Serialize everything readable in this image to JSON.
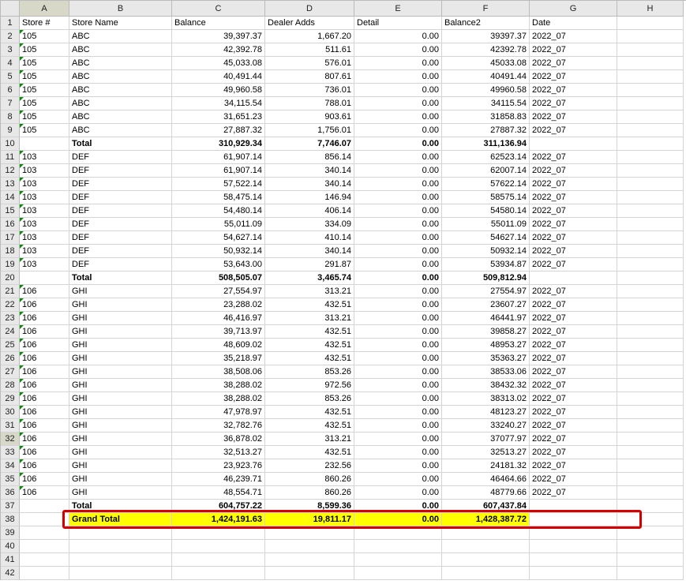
{
  "columns": [
    "",
    "A",
    "B",
    "C",
    "D",
    "E",
    "F",
    "G",
    "H"
  ],
  "headers": {
    "A": "Store #",
    "B": "Store Name",
    "C": "Balance",
    "D": "Dealer Adds",
    "E": "Detail",
    "F": "Balance2",
    "G": "Date"
  },
  "rows": [
    {
      "r": 2,
      "A": "105",
      "B": "ABC",
      "C": "39,397.37",
      "D": "1,667.20",
      "E": "0.00",
      "F": "39397.37",
      "G": "2022_07"
    },
    {
      "r": 3,
      "A": "105",
      "B": "ABC",
      "C": "42,392.78",
      "D": "511.61",
      "E": "0.00",
      "F": "42392.78",
      "G": "2022_07"
    },
    {
      "r": 4,
      "A": "105",
      "B": "ABC",
      "C": "45,033.08",
      "D": "576.01",
      "E": "0.00",
      "F": "45033.08",
      "G": "2022_07"
    },
    {
      "r": 5,
      "A": "105",
      "B": "ABC",
      "C": "40,491.44",
      "D": "807.61",
      "E": "0.00",
      "F": "40491.44",
      "G": "2022_07"
    },
    {
      "r": 6,
      "A": "105",
      "B": "ABC",
      "C": "49,960.58",
      "D": "736.01",
      "E": "0.00",
      "F": "49960.58",
      "G": "2022_07"
    },
    {
      "r": 7,
      "A": "105",
      "B": "ABC",
      "C": "34,115.54",
      "D": "788.01",
      "E": "0.00",
      "F": "34115.54",
      "G": "2022_07"
    },
    {
      "r": 8,
      "A": "105",
      "B": "ABC",
      "C": "31,651.23",
      "D": "903.61",
      "E": "0.00",
      "F": "31858.83",
      "G": "2022_07"
    },
    {
      "r": 9,
      "A": "105",
      "B": "ABC",
      "C": "27,887.32",
      "D": "1,756.01",
      "E": "0.00",
      "F": "27887.32",
      "G": "2022_07"
    },
    {
      "r": 10,
      "total": true,
      "B": "Total",
      "C": "310,929.34",
      "D": "7,746.07",
      "E": "0.00",
      "F": "311,136.94"
    },
    {
      "r": 11,
      "A": "103",
      "B": "DEF",
      "C": "61,907.14",
      "D": "856.14",
      "E": "0.00",
      "F": "62523.14",
      "G": "2022_07"
    },
    {
      "r": 12,
      "A": "103",
      "B": "DEF",
      "C": "61,907.14",
      "D": "340.14",
      "E": "0.00",
      "F": "62007.14",
      "G": "2022_07"
    },
    {
      "r": 13,
      "A": "103",
      "B": "DEF",
      "C": "57,522.14",
      "D": "340.14",
      "E": "0.00",
      "F": "57622.14",
      "G": "2022_07"
    },
    {
      "r": 14,
      "A": "103",
      "B": "DEF",
      "C": "58,475.14",
      "D": "146.94",
      "E": "0.00",
      "F": "58575.14",
      "G": "2022_07"
    },
    {
      "r": 15,
      "A": "103",
      "B": "DEF",
      "C": "54,480.14",
      "D": "406.14",
      "E": "0.00",
      "F": "54580.14",
      "G": "2022_07"
    },
    {
      "r": 16,
      "A": "103",
      "B": "DEF",
      "C": "55,011.09",
      "D": "334.09",
      "E": "0.00",
      "F": "55011.09",
      "G": "2022_07"
    },
    {
      "r": 17,
      "A": "103",
      "B": "DEF",
      "C": "54,627.14",
      "D": "410.14",
      "E": "0.00",
      "F": "54627.14",
      "G": "2022_07"
    },
    {
      "r": 18,
      "A": "103",
      "B": "DEF",
      "C": "50,932.14",
      "D": "340.14",
      "E": "0.00",
      "F": "50932.14",
      "G": "2022_07"
    },
    {
      "r": 19,
      "A": "103",
      "B": "DEF",
      "C": "53,643.00",
      "D": "291.87",
      "E": "0.00",
      "F": "53934.87",
      "G": "2022_07"
    },
    {
      "r": 20,
      "total": true,
      "B": "Total",
      "C": "508,505.07",
      "D": "3,465.74",
      "E": "0.00",
      "F": "509,812.94"
    },
    {
      "r": 21,
      "A": "106",
      "B": "GHI",
      "C": "27,554.97",
      "D": "313.21",
      "E": "0.00",
      "F": "27554.97",
      "G": "2022_07"
    },
    {
      "r": 22,
      "A": "106",
      "B": "GHI",
      "C": "23,288.02",
      "D": "432.51",
      "E": "0.00",
      "F": "23607.27",
      "G": "2022_07"
    },
    {
      "r": 23,
      "A": "106",
      "B": "GHI",
      "C": "46,416.97",
      "D": "313.21",
      "E": "0.00",
      "F": "46441.97",
      "G": "2022_07"
    },
    {
      "r": 24,
      "A": "106",
      "B": "GHI",
      "C": "39,713.97",
      "D": "432.51",
      "E": "0.00",
      "F": "39858.27",
      "G": "2022_07"
    },
    {
      "r": 25,
      "A": "106",
      "B": "GHI",
      "C": "48,609.02",
      "D": "432.51",
      "E": "0.00",
      "F": "48953.27",
      "G": "2022_07"
    },
    {
      "r": 26,
      "A": "106",
      "B": "GHI",
      "C": "35,218.97",
      "D": "432.51",
      "E": "0.00",
      "F": "35363.27",
      "G": "2022_07"
    },
    {
      "r": 27,
      "A": "106",
      "B": "GHI",
      "C": "38,508.06",
      "D": "853.26",
      "E": "0.00",
      "F": "38533.06",
      "G": "2022_07"
    },
    {
      "r": 28,
      "A": "106",
      "B": "GHI",
      "C": "38,288.02",
      "D": "972.56",
      "E": "0.00",
      "F": "38432.32",
      "G": "2022_07"
    },
    {
      "r": 29,
      "A": "106",
      "B": "GHI",
      "C": "38,288.02",
      "D": "853.26",
      "E": "0.00",
      "F": "38313.02",
      "G": "2022_07"
    },
    {
      "r": 30,
      "A": "106",
      "B": "GHI",
      "C": "47,978.97",
      "D": "432.51",
      "E": "0.00",
      "F": "48123.27",
      "G": "2022_07"
    },
    {
      "r": 31,
      "A": "106",
      "B": "GHI",
      "C": "32,782.76",
      "D": "432.51",
      "E": "0.00",
      "F": "33240.27",
      "G": "2022_07"
    },
    {
      "r": 32,
      "A": "106",
      "B": "GHI",
      "C": "36,878.02",
      "D": "313.21",
      "E": "0.00",
      "F": "37077.97",
      "G": "2022_07"
    },
    {
      "r": 33,
      "A": "106",
      "B": "GHI",
      "C": "32,513.27",
      "D": "432.51",
      "E": "0.00",
      "F": "32513.27",
      "G": "2022_07"
    },
    {
      "r": 34,
      "A": "106",
      "B": "GHI",
      "C": "23,923.76",
      "D": "232.56",
      "E": "0.00",
      "F": "24181.32",
      "G": "2022_07"
    },
    {
      "r": 35,
      "A": "106",
      "B": "GHI",
      "C": "46,239.71",
      "D": "860.26",
      "E": "0.00",
      "F": "46464.66",
      "G": "2022_07"
    },
    {
      "r": 36,
      "A": "106",
      "B": "GHI",
      "C": "48,554.71",
      "D": "860.26",
      "E": "0.00",
      "F": "48779.66",
      "G": "2022_07"
    },
    {
      "r": 37,
      "total": true,
      "B": "Total",
      "C": "604,757.22",
      "D": "8,599.36",
      "E": "0.00",
      "F": "607,437.84"
    },
    {
      "r": 38,
      "grand": true,
      "B": "Grand Total",
      "C": "1,424,191.63",
      "D": "19,811.17",
      "E": "0.00",
      "F": "1,428,387.72"
    },
    {
      "r": 39
    },
    {
      "r": 40
    },
    {
      "r": 41
    },
    {
      "r": 42
    }
  ],
  "selected_col": "A",
  "selected_row": 32
}
